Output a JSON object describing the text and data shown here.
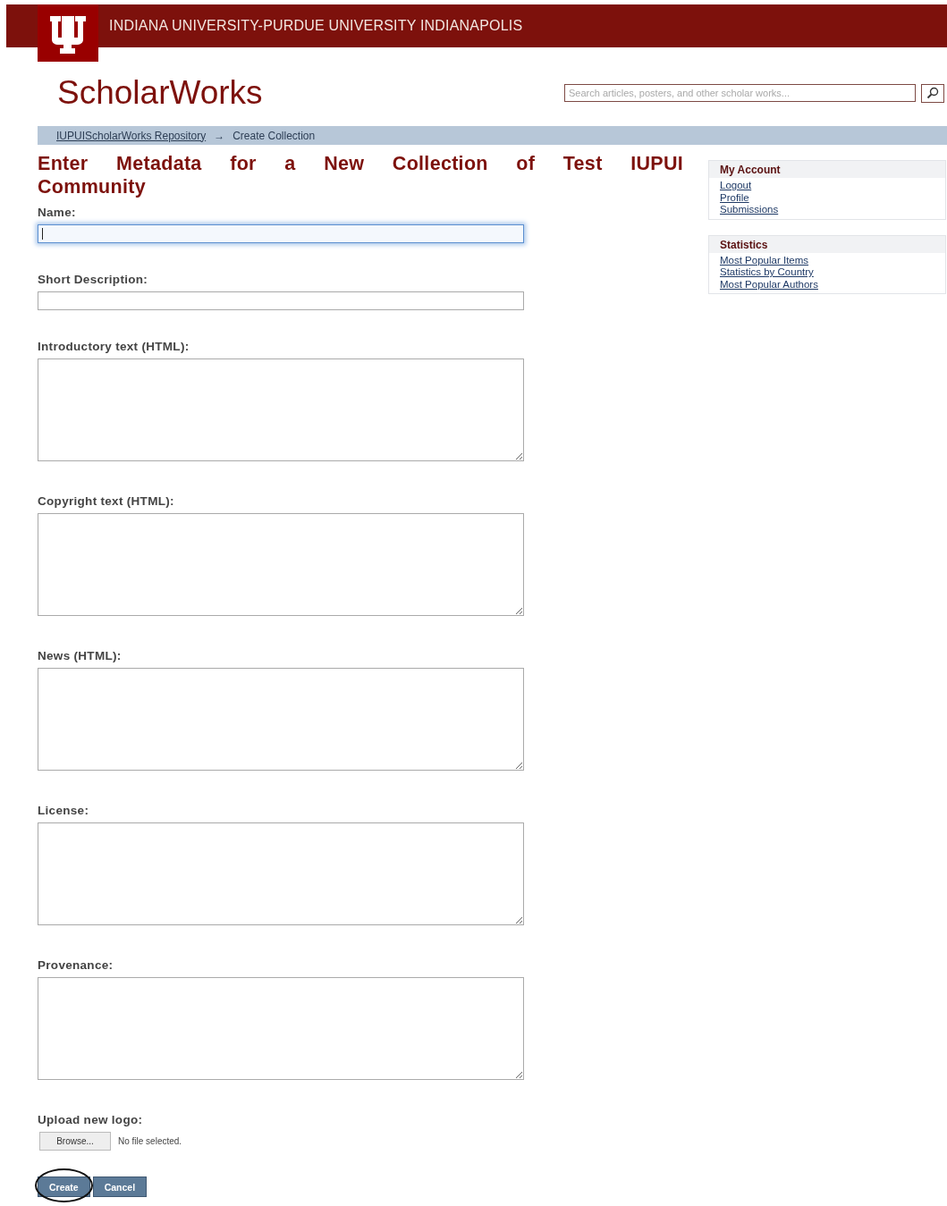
{
  "header": {
    "university": "INDIANA UNIVERSITY-PURDUE UNIVERSITY INDIANAPOLIS"
  },
  "site_title": "ScholarWorks",
  "search": {
    "placeholder": "Search articles, posters, and other scholar works..."
  },
  "breadcrumb": [
    {
      "label": "IUPUIScholarWorks Repository",
      "kind": "link"
    },
    {
      "label": "→",
      "kind": "separator"
    },
    {
      "label": "Create Collection",
      "kind": "current"
    }
  ],
  "heading": "Enter Metadata for a New Collection of Test IUPUI Community",
  "fields": [
    {
      "label": "Name:",
      "kind": "text",
      "focused": true
    },
    {
      "label": "Short Description:",
      "kind": "text",
      "focused": false
    },
    {
      "label": "Introductory text (HTML):",
      "kind": "textarea",
      "focused": false
    },
    {
      "label": "Copyright text (HTML):",
      "kind": "textarea",
      "focused": false
    },
    {
      "label": "News (HTML):",
      "kind": "textarea",
      "focused": false
    },
    {
      "label": "License:",
      "kind": "textarea",
      "focused": false
    },
    {
      "label": "Provenance:",
      "kind": "textarea",
      "focused": false
    },
    {
      "label": "Upload new logo:",
      "kind": "file",
      "button": "Browse...",
      "status": "No file selected."
    }
  ],
  "buttons": [
    {
      "label": "Create",
      "highlighted": true
    },
    {
      "label": "Cancel",
      "highlighted": false
    }
  ],
  "sidebar": [
    {
      "title": "My Account",
      "links": [
        "Logout",
        "Profile",
        "Submissions"
      ]
    },
    {
      "title": "Statistics",
      "links": [
        "Most Popular Items",
        "Statistics by Country",
        "Most Popular Authors"
      ]
    }
  ]
}
